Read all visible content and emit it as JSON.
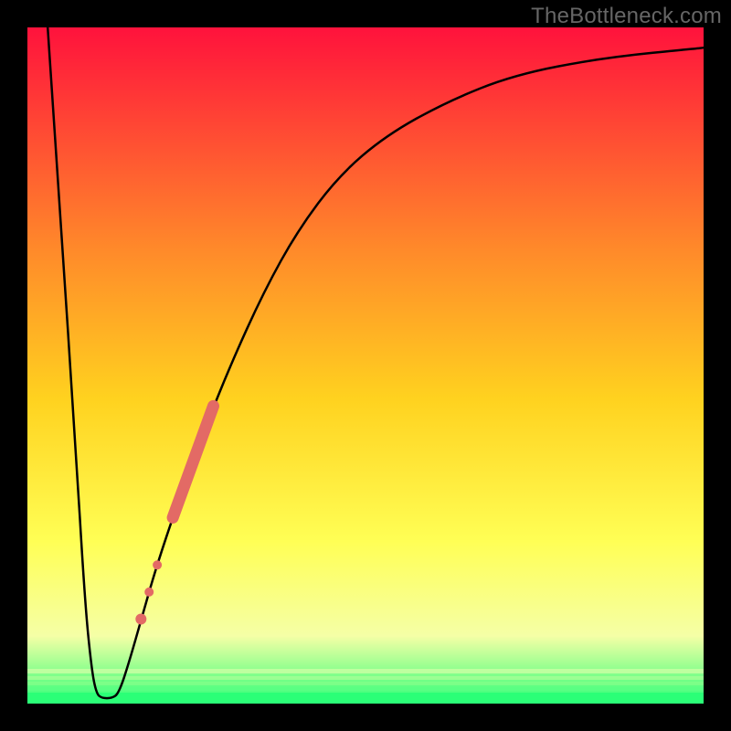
{
  "watermark": "TheBottleneck.com",
  "colors": {
    "bg_top": "#ff123c",
    "bg_mid1": "#ff8a2a",
    "bg_mid2": "#ffd21f",
    "bg_mid3": "#ffff55",
    "bg_mid4": "#f5ffa6",
    "bg_bottom": "#2bff77",
    "frame": "#000000",
    "curve": "#000000",
    "points": "#e36a65"
  },
  "chart_data": {
    "type": "line",
    "title": "",
    "xlabel": "",
    "ylabel": "",
    "x_range": [
      0,
      100
    ],
    "y_range": [
      0,
      100
    ],
    "curve": [
      {
        "x": 3,
        "y": 100
      },
      {
        "x": 5,
        "y": 70
      },
      {
        "x": 7,
        "y": 40
      },
      {
        "x": 8.5,
        "y": 15
      },
      {
        "x": 9.5,
        "y": 5
      },
      {
        "x": 10.2,
        "y": 1.5
      },
      {
        "x": 11.0,
        "y": 0.8
      },
      {
        "x": 12.5,
        "y": 0.8
      },
      {
        "x": 13.5,
        "y": 1.5
      },
      {
        "x": 15,
        "y": 6
      },
      {
        "x": 17,
        "y": 13
      },
      {
        "x": 19,
        "y": 20
      },
      {
        "x": 22,
        "y": 29
      },
      {
        "x": 26,
        "y": 40
      },
      {
        "x": 30,
        "y": 50
      },
      {
        "x": 35,
        "y": 61
      },
      {
        "x": 40,
        "y": 70
      },
      {
        "x": 46,
        "y": 78
      },
      {
        "x": 53,
        "y": 84
      },
      {
        "x": 62,
        "y": 89
      },
      {
        "x": 72,
        "y": 93
      },
      {
        "x": 85,
        "y": 95.5
      },
      {
        "x": 100,
        "y": 97
      }
    ],
    "thick_segment": [
      {
        "x": 21.5,
        "y": 27.5
      },
      {
        "x": 27.5,
        "y": 44
      }
    ],
    "points": [
      {
        "x": 19.2,
        "y": 20.5,
        "r": 5
      },
      {
        "x": 18.0,
        "y": 16.5,
        "r": 5
      },
      {
        "x": 16.8,
        "y": 12.5,
        "r": 6
      }
    ]
  }
}
